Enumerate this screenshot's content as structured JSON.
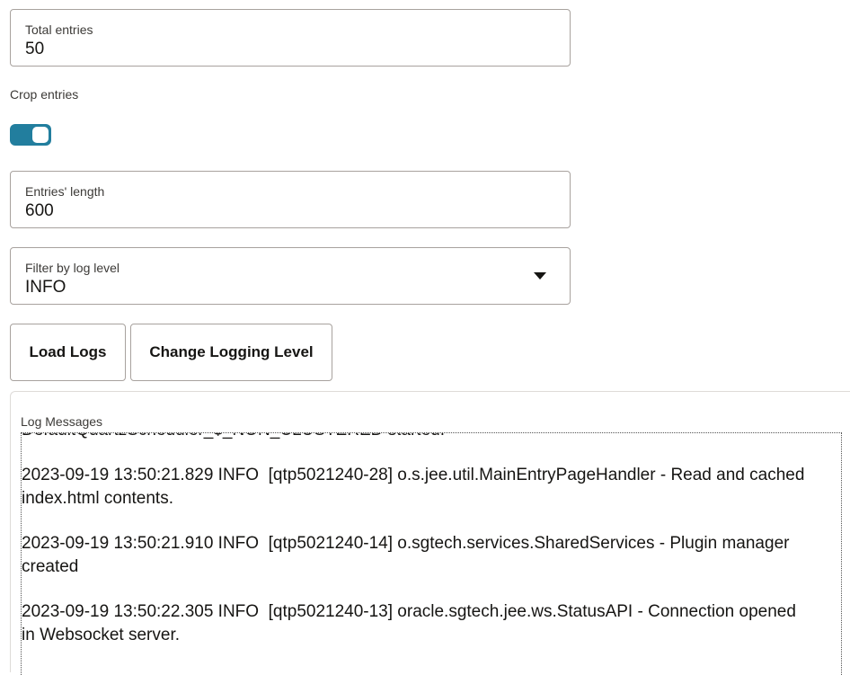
{
  "total_entries": {
    "label": "Total entries",
    "value": "50"
  },
  "crop_entries": {
    "label": "Crop entries",
    "enabled": true
  },
  "entries_length": {
    "label": "Entries' length",
    "value": "600"
  },
  "log_level_filter": {
    "label": "Filter by log level",
    "value": "INFO"
  },
  "buttons": {
    "load_logs": "Load Logs",
    "change_logging_level": "Change Logging Level"
  },
  "log_messages": {
    "label": "Log Messages",
    "lines": [
      "DefaultQuartzScheduler_$_NON_CLUSTERED started.",
      "2023-09-19 13:50:21.829 INFO  [qtp5021240-28] o.s.jee.util.MainEntryPageHandler - Read and cached index.html contents.",
      "2023-09-19 13:50:21.910 INFO  [qtp5021240-14] o.sgtech.services.SharedServices - Plugin manager created",
      "2023-09-19 13:50:22.305 INFO  [qtp5021240-13] oracle.sgtech.jee.ws.StatusAPI - Connection opened in Websocket server."
    ]
  },
  "colors": {
    "toggle_on": "#227e9e",
    "border": "#a8a29e"
  }
}
